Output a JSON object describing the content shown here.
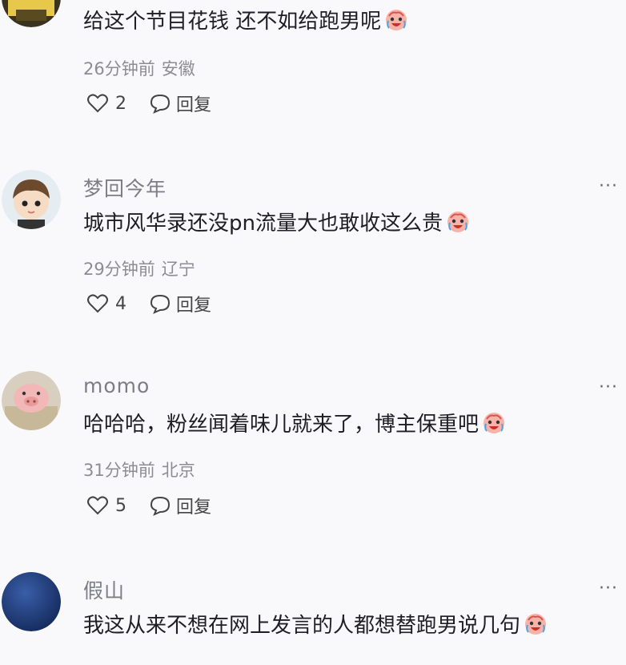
{
  "comments": [
    {
      "username": "",
      "text": "给这个节目花钱 还不如给跑男呢",
      "emoji": "crying-laughing-emoji",
      "time": "26分钟前",
      "location": "安徽",
      "likes": "2",
      "reply_label": "回复"
    },
    {
      "username": "梦回今年",
      "text": "城市风华录还没pn流量大也敢收这么贵",
      "emoji": "crying-laughing-emoji",
      "time": "29分钟前",
      "location": "辽宁",
      "likes": "4",
      "reply_label": "回复"
    },
    {
      "username": "momo",
      "text": "哈哈哈，粉丝闻着味儿就来了，博主保重吧",
      "emoji": "crying-laughing-emoji",
      "time": "31分钟前",
      "location": "北京",
      "likes": "5",
      "reply_label": "回复"
    },
    {
      "username": "假山",
      "text": "我这从来不想在网上发言的人都想替跑男说几句",
      "emoji": "crying-laughing-emoji",
      "time": "",
      "location": "",
      "likes": "",
      "reply_label": ""
    }
  ],
  "more_icon": "···",
  "colors": {
    "background": "#f9f9fb",
    "text": "#1e1e24",
    "secondary": "#8c8c93"
  }
}
